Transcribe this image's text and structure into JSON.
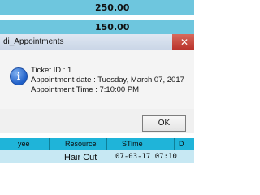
{
  "background_table": {
    "row1_value": "250.00",
    "row2_value": "150.00"
  },
  "dialog": {
    "title": "di_Appointments",
    "close_label": "✕",
    "icon": "info-icon",
    "lines": [
      "Ticket ID : 1",
      "Appointment date : Tuesday, March 07, 2017",
      "Appointment Time : 7:10:00 PM"
    ],
    "ok_label": "OK"
  },
  "grid": {
    "headers": [
      "yee",
      "Resource",
      "STime",
      "D"
    ],
    "row": {
      "resource": "Hair Cut",
      "stime": "07-03-17 07:10"
    }
  },
  "colors": {
    "row_highlight": "#6ec6de",
    "grid_header": "#1fb4d9",
    "grid_row": "#c7e8f3"
  }
}
